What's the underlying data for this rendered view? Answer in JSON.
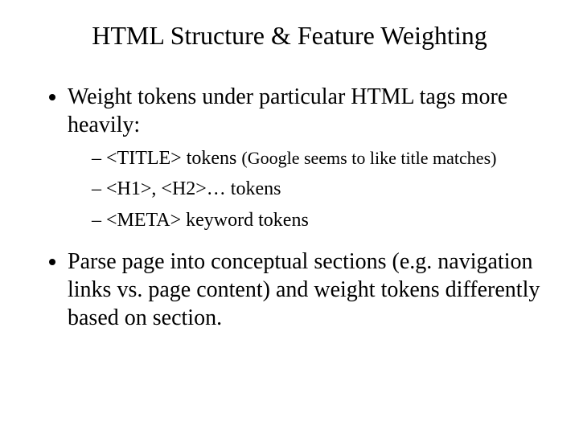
{
  "title": "HTML Structure & Feature Weighting",
  "bullets": {
    "b1": "Weight tokens under particular HTML tags more heavily:",
    "sub1_a": "<TITLE> tokens ",
    "sub1_a_note": "(Google seems to like title matches)",
    "sub1_b": "<H1>, <H2>… tokens",
    "sub1_c": "<META> keyword tokens",
    "b2": "Parse page into conceptual sections (e.g. navigation links vs. page content) and weight tokens differently based on section."
  }
}
